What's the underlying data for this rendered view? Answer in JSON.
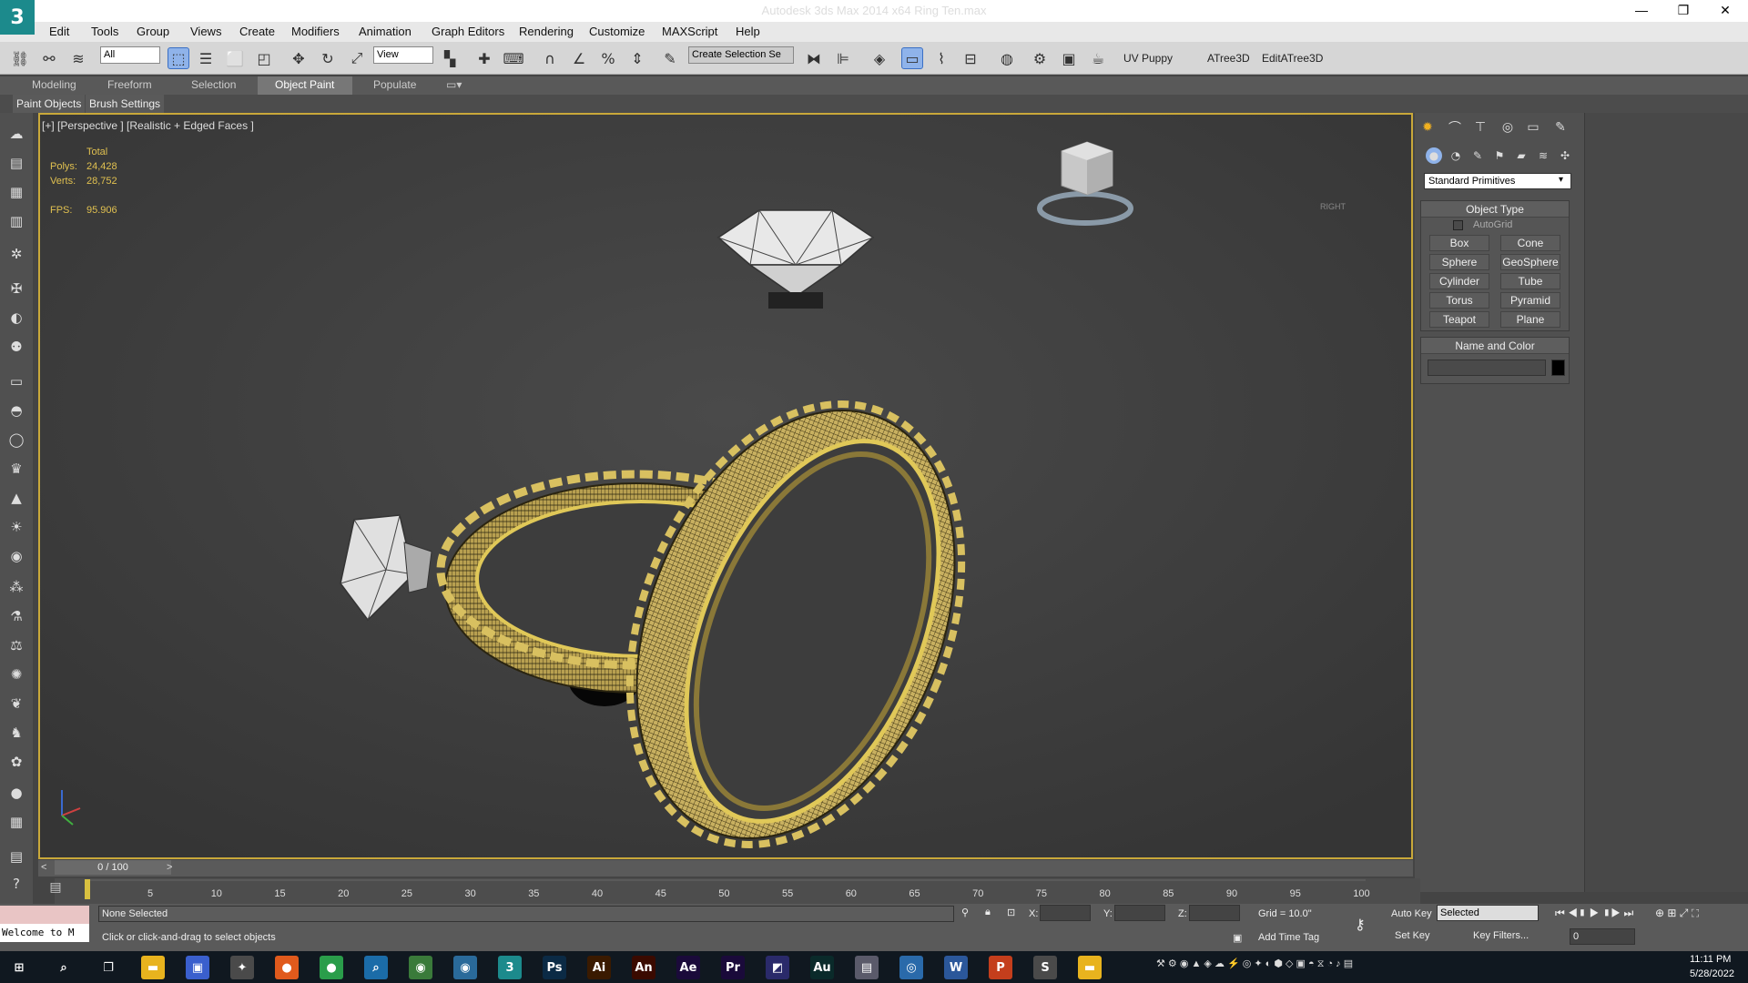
{
  "window": {
    "title": "Autodesk 3ds Max  2014 x64     Ring Ten.max",
    "logo_glyph": "3",
    "minimize_glyph": "—",
    "maximize_glyph": "❐",
    "close_glyph": "✕"
  },
  "menu": [
    "Edit",
    "Tools",
    "Group",
    "Views",
    "Create",
    "Modifiers",
    "Animation",
    "Graph Editors",
    "Rendering",
    "Customize",
    "MAXScript",
    "Help"
  ],
  "toolbar": {
    "selection_filter": "All",
    "reference_coord": "View",
    "named_selection_placeholder": "Create Selection Se",
    "uv_puppy": "UV Puppy",
    "atree": "ATree3D",
    "edit_atree": "EditATree3D"
  },
  "ribbon": {
    "tabs": [
      "Modeling",
      "Freeform",
      "Selection",
      "Object Paint",
      "Populate"
    ],
    "active_tab": "Object Paint",
    "subtabs": [
      "Paint Objects",
      "Brush Settings"
    ]
  },
  "viewport": {
    "label": "[+] [Perspective ] [Realistic + Edged Faces ]",
    "stats_header": "Total",
    "polys_label": "Polys:",
    "polys_value": "24,428",
    "verts_label": "Verts:",
    "verts_value": "28,752",
    "fps_label": "FPS:",
    "fps_value": "95.906",
    "viewcube_label": "RIGHT"
  },
  "command_panel": {
    "category": "Standard Primitives",
    "object_type_title": "Object Type",
    "autogrid_label": "AutoGrid",
    "primitives": [
      "Box",
      "Cone",
      "Sphere",
      "GeoSphere",
      "Cylinder",
      "Tube",
      "Torus",
      "Pyramid",
      "Teapot",
      "Plane"
    ],
    "name_color_title": "Name and Color",
    "object_color": "#000000"
  },
  "timeline": {
    "frame_display": "0 / 100",
    "ticks": [
      "5",
      "10",
      "15",
      "20",
      "25",
      "30",
      "35",
      "40",
      "45",
      "50",
      "55",
      "60",
      "65",
      "70",
      "75",
      "80",
      "85",
      "90",
      "95",
      "100"
    ],
    "prev_glyph": "<",
    "next_glyph": ">"
  },
  "status": {
    "maxscript_text": "Welcome to M",
    "selection_status": "None Selected",
    "prompt": "Click or click-and-drag to select objects",
    "x_label": "X:",
    "y_label": "Y:",
    "z_label": "Z:",
    "grid": "Grid = 10.0\"",
    "add_time_tag": "Add Time Tag",
    "auto_key": "Auto Key",
    "set_key": "Set Key",
    "key_mode": "Selected",
    "key_filters": "Key Filters...",
    "current_frame": "0"
  },
  "taskbar": {
    "time": "11:11 PM",
    "date": "5/28/2022",
    "apps": [
      {
        "name": "start-icon",
        "glyph": "⊞",
        "color": "#101820"
      },
      {
        "name": "search-icon",
        "glyph": "⌕",
        "color": "#101820"
      },
      {
        "name": "task-view-icon",
        "glyph": "❐",
        "color": "#101820"
      },
      {
        "name": "file-explorer-icon",
        "glyph": "▬",
        "color": "#e8b31e"
      },
      {
        "name": "app-icon",
        "glyph": "▣",
        "color": "#3a5fcd"
      },
      {
        "name": "app-icon",
        "glyph": "✦",
        "color": "#4a4a4a"
      },
      {
        "name": "firefox-icon",
        "glyph": "●",
        "color": "#e05a1c"
      },
      {
        "name": "chrome-icon",
        "glyph": "●",
        "color": "#2a9d4a"
      },
      {
        "name": "app-icon",
        "glyph": "⌕",
        "color": "#1b6ca8"
      },
      {
        "name": "app-icon",
        "glyph": "◉",
        "color": "#3a7a3a"
      },
      {
        "name": "app-icon",
        "glyph": "◉",
        "color": "#2a6a9a"
      },
      {
        "name": "3dsmax-icon",
        "glyph": "3",
        "color": "#1c8a8c"
      },
      {
        "name": "photoshop-icon",
        "glyph": "Ps",
        "color": "#0b2a45"
      },
      {
        "name": "illustrator-icon",
        "glyph": "Ai",
        "color": "#3a1a00"
      },
      {
        "name": "animate-icon",
        "glyph": "An",
        "color": "#3a0a00"
      },
      {
        "name": "after-effects-icon",
        "glyph": "Ae",
        "color": "#1a0a3a"
      },
      {
        "name": "premiere-icon",
        "glyph": "Pr",
        "color": "#1a0a3a"
      },
      {
        "name": "app-icon",
        "glyph": "◩",
        "color": "#2a2a6a"
      },
      {
        "name": "audition-icon",
        "glyph": "Au",
        "color": "#0a2a2a"
      },
      {
        "name": "app-icon",
        "glyph": "▤",
        "color": "#5a5a6a"
      },
      {
        "name": "app-icon",
        "glyph": "◎",
        "color": "#2a6aaa"
      },
      {
        "name": "word-icon",
        "glyph": "W",
        "color": "#2b579a"
      },
      {
        "name": "powerpoint-icon",
        "glyph": "P",
        "color": "#c43e1c"
      },
      {
        "name": "sublime-icon",
        "glyph": "S",
        "color": "#4a4a4a"
      },
      {
        "name": "folder-icon",
        "glyph": "▬",
        "color": "#e8b31e"
      }
    ]
  },
  "colors": {
    "accent_viewport_border": "#c9a83a",
    "ring_gold": "#c9a83a",
    "active_tool": "#8fb3ea"
  }
}
